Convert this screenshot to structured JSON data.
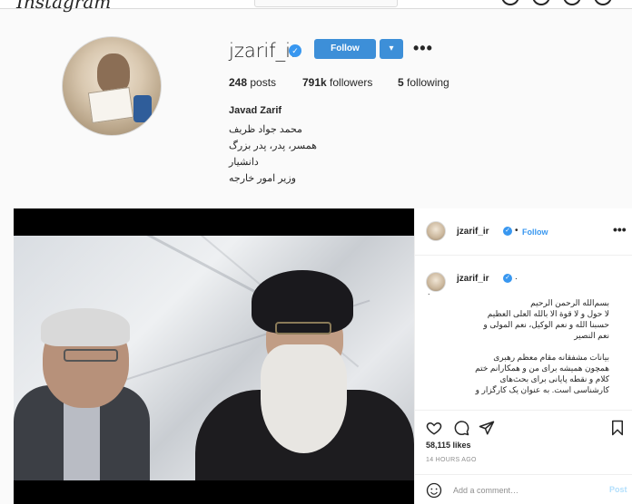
{
  "nav": {
    "logo": "Instagram"
  },
  "profile": {
    "username": "jzarif_ir",
    "follow_label": "Follow",
    "follow_dropdown_icon": "chevron-down-icon",
    "more_label": "•••",
    "stats": {
      "posts": "248",
      "posts_label": "posts",
      "followers": "791k",
      "followers_label": "followers",
      "following": "5",
      "following_label": "following"
    },
    "full_name": "Javad Zarif",
    "bio_lines": [
      "محمد جواد ظریف",
      "همسر، پدر، پدر بزرگ",
      "دانشیار",
      "وزیر امور خارجه"
    ]
  },
  "post": {
    "header": {
      "username": "jzarif_ir",
      "dot": "•",
      "follow_label": "Follow",
      "more_label": "•••"
    },
    "caption": {
      "username": "jzarif_ir",
      "dot": ".",
      "first_line": ".",
      "paragraph1": "بسم‌الله الرحمن الرحیم\nلا حول و لا قوة الا بالله العلی العظیم\nحسبنا الله و نعم الوکیل، نعم المولی و\nنعم النصیر",
      "paragraph2": "بیانات مشفقانه مقام معظم رهبری\nهمچون همیشه برای من و همکارانم ختم\nکلام و نقطه پایانی برای بحث‌های\nکارشناسی است. به عنوان یک کارگزار و"
    },
    "likes": "58,115 likes",
    "time": "14 HOURS AGO",
    "comment_placeholder": "Add a comment…",
    "post_label": "Post"
  },
  "colors": {
    "accent": "#3897f0",
    "follow_button": "#3d8fd8",
    "post_disabled": "#b2dffc"
  }
}
